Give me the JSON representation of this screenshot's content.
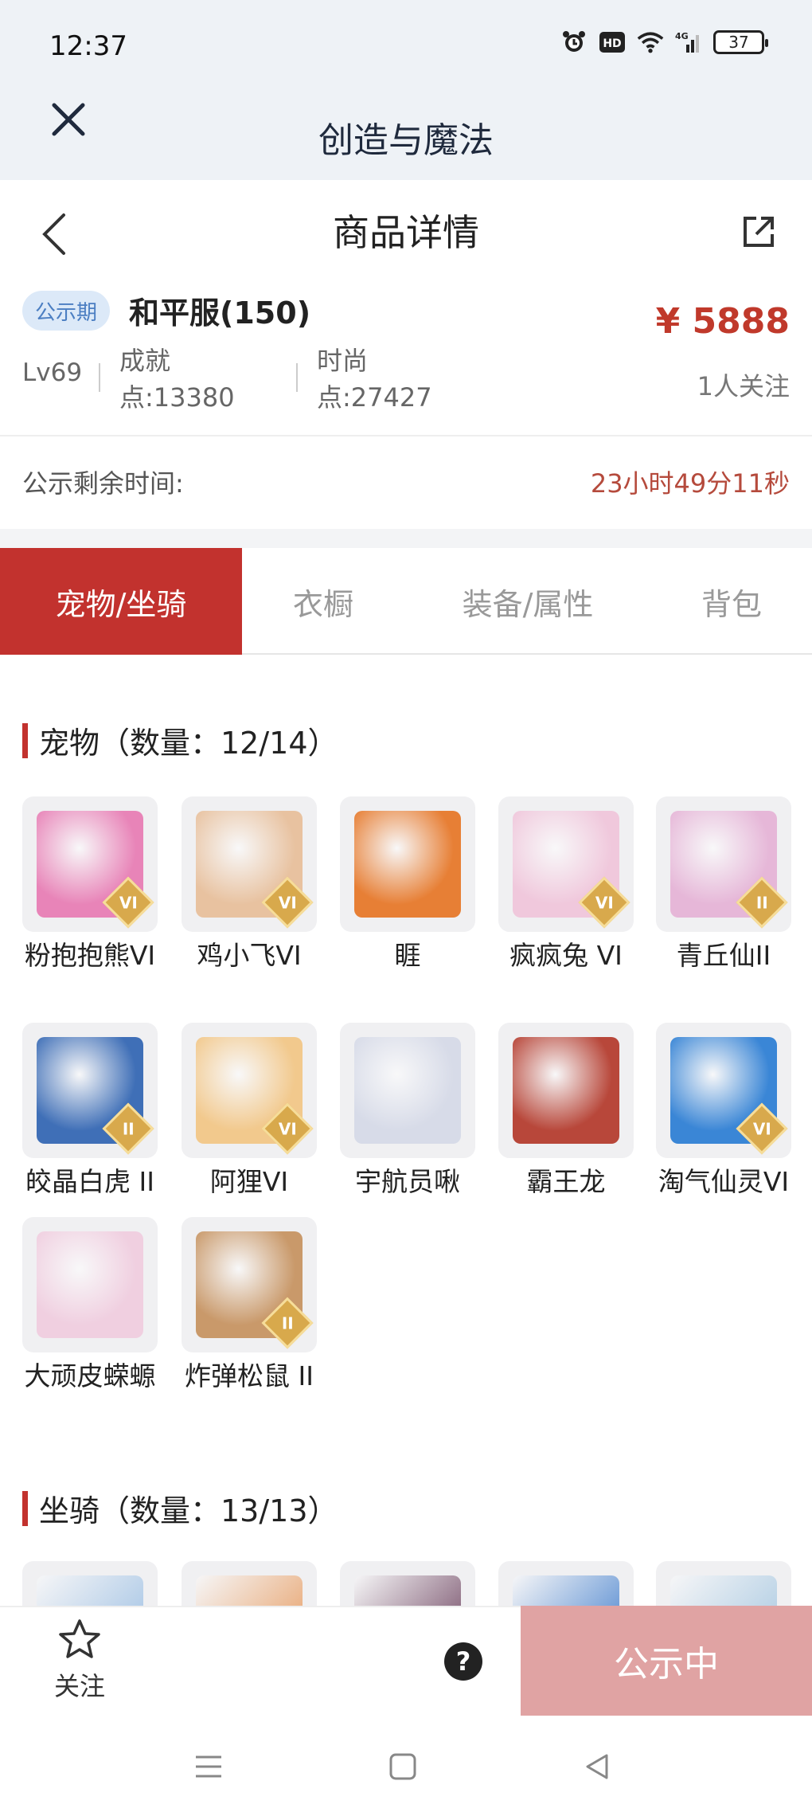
{
  "status_bar": {
    "time": "12:37",
    "battery": "37",
    "network_label": "4G",
    "hd_label": "HD"
  },
  "app_bar": {
    "title": "创造与魔法"
  },
  "nav": {
    "title": "商品详情"
  },
  "product": {
    "badge": "公示期",
    "server": "和平服(150)",
    "price": "¥ 5888",
    "level": "Lv69",
    "achievement_label": "成就",
    "achievement_value": "点:13380",
    "fashion_label": "时尚",
    "fashion_value": "点:27427",
    "followers": "1人关注"
  },
  "countdown": {
    "label": "公示剩余时间:",
    "value": "23小时49分11秒"
  },
  "tabs": [
    "宠物/坐骑",
    "衣橱",
    "装备/属性",
    "背包"
  ],
  "pets": {
    "title": "宠物（数量：12/14）",
    "items": [
      {
        "name": "粉抱抱熊VI",
        "rank": "VI",
        "color": "#e884b8"
      },
      {
        "name": "鸡小飞VI",
        "rank": "VI",
        "color": "#e8c2a0"
      },
      {
        "name": "睚",
        "rank": "",
        "color": "#e77f35"
      },
      {
        "name": "疯疯兔 VI",
        "rank": "VI",
        "color": "#f0c8dc"
      },
      {
        "name": "青丘仙II",
        "rank": "II",
        "color": "#e6b7d8"
      },
      {
        "name": "皎晶白虎 II",
        "rank": "II",
        "color": "#3f6fb7"
      },
      {
        "name": "阿狸VI",
        "rank": "VI",
        "color": "#f2c98d"
      },
      {
        "name": "宇航员啾",
        "rank": "",
        "color": "#d7dbe8"
      },
      {
        "name": "霸王龙",
        "rank": "",
        "color": "#b8473a"
      },
      {
        "name": "淘气仙灵VI",
        "rank": "VI",
        "color": "#3a86d6"
      },
      {
        "name": "大顽皮蝾螈",
        "rank": "",
        "color": "#f0cfe0"
      },
      {
        "name": "炸弹松鼠 II",
        "rank": "II",
        "color": "#c9996a"
      }
    ]
  },
  "mounts": {
    "title": "坐骑（数量：13/13）",
    "items": [
      {
        "color": "#8fb7e0"
      },
      {
        "color": "#e48e4a"
      },
      {
        "color": "#5a2a4a"
      },
      {
        "color": "#2b6fc7"
      },
      {
        "color": "#9ac0dd"
      }
    ]
  },
  "bottom": {
    "follow_label": "关注",
    "help_label": "?",
    "status_label": "公示中"
  }
}
